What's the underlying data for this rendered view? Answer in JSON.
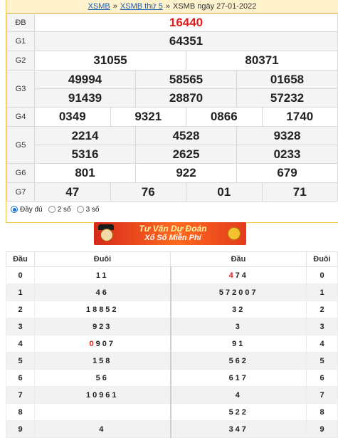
{
  "breadcrumb": {
    "link1": "XSMB",
    "sep1": "»",
    "link2": "XSMB thứ 5",
    "sep2": "»",
    "current": "XSMB ngày 27-01-2022"
  },
  "results": {
    "db": {
      "label": "ĐB",
      "value": "16440"
    },
    "g1": {
      "label": "G1",
      "value": "64351"
    },
    "g2": {
      "label": "G2",
      "values": [
        "31055",
        "80371"
      ]
    },
    "g3": {
      "label": "G3",
      "values": [
        "49994",
        "58565",
        "01658",
        "91439",
        "28870",
        "57232"
      ]
    },
    "g4": {
      "label": "G4",
      "values": [
        "0349",
        "9321",
        "0866",
        "1740"
      ]
    },
    "g5": {
      "label": "G5",
      "values": [
        "2214",
        "4528",
        "9328",
        "5316",
        "2625",
        "0233"
      ]
    },
    "g6": {
      "label": "G6",
      "values": [
        "801",
        "922",
        "679"
      ]
    },
    "g7": {
      "label": "G7",
      "values": [
        "47",
        "76",
        "01",
        "71"
      ]
    }
  },
  "options": {
    "full": "Đầy đủ",
    "two": "2 số",
    "three": "3 số",
    "selected": "full"
  },
  "banner": {
    "line1": "Tư Vấn Dự Đoán",
    "line2": "Xổ Số Miễn Phí"
  },
  "loto": {
    "headers": {
      "dau": "Đầu",
      "duoi": "Đuôi",
      "dau2": "Đầu",
      "duoi2": "Đuôi"
    },
    "rows": [
      {
        "dau": "0",
        "duoi_a": "",
        "duoi_b": "11",
        "dau_a": "4",
        "dau_b": "74",
        "duoi": "0"
      },
      {
        "dau": "1",
        "duoi_a": "",
        "duoi_b": "46",
        "dau_a": "",
        "dau_b": "572007",
        "duoi": "1"
      },
      {
        "dau": "2",
        "duoi_a": "",
        "duoi_b": "18852",
        "dau_a": "",
        "dau_b": "32",
        "duoi": "2"
      },
      {
        "dau": "3",
        "duoi_a": "",
        "duoi_b": "923",
        "dau_a": "",
        "dau_b": "3",
        "duoi": "3"
      },
      {
        "dau": "4",
        "duoi_a": "0",
        "duoi_b": "907",
        "dau_a": "",
        "dau_b": "91",
        "duoi": "4"
      },
      {
        "dau": "5",
        "duoi_a": "",
        "duoi_b": "158",
        "dau_a": "",
        "dau_b": "562",
        "duoi": "5"
      },
      {
        "dau": "6",
        "duoi_a": "",
        "duoi_b": "56",
        "dau_a": "",
        "dau_b": "617",
        "duoi": "6"
      },
      {
        "dau": "7",
        "duoi_a": "",
        "duoi_b": "10961",
        "dau_a": "",
        "dau_b": "4",
        "duoi": "7"
      },
      {
        "dau": "8",
        "duoi_a": "",
        "duoi_b": "",
        "dau_a": "",
        "dau_b": "522",
        "duoi": "8"
      },
      {
        "dau": "9",
        "duoi_a": "",
        "duoi_b": "4",
        "dau_a": "",
        "dau_b": "347",
        "duoi": "9"
      }
    ]
  },
  "colors": {
    "accent_red": "#e11d1d",
    "border_gold": "#f3c24b",
    "link_blue": "#1a5fb4"
  }
}
